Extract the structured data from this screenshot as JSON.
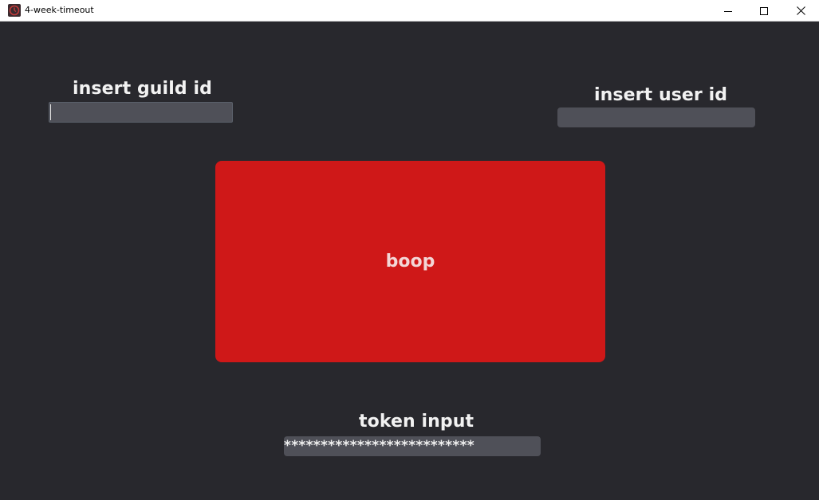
{
  "window": {
    "title": "4-week-timeout",
    "icon": "clock-icon",
    "controls": {
      "minimize_icon": "minimize-icon",
      "maximize_icon": "maximize-icon",
      "close_icon": "close-icon"
    }
  },
  "form": {
    "guild": {
      "label": "insert guild id",
      "value": ""
    },
    "user": {
      "label": "insert user id",
      "value": ""
    },
    "token": {
      "label": "token input",
      "value": "**************************"
    },
    "submit_label": "boop"
  },
  "colors": {
    "background": "#28282d",
    "input": "#4f5058",
    "button": "#cf1818",
    "label": "#f2f2f2"
  }
}
